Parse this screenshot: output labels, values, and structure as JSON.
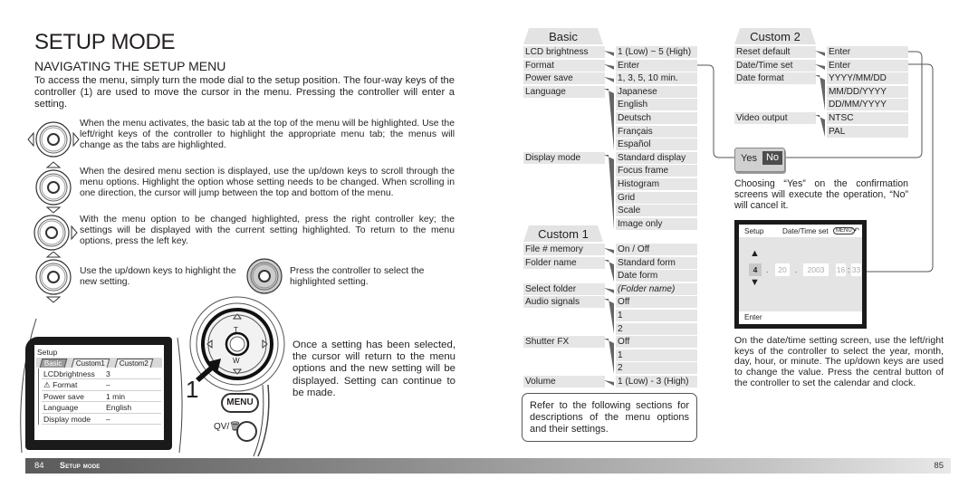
{
  "left_page": {
    "title": "SETUP MODE",
    "section": "NAVIGATING THE SETUP MENU",
    "intro": "To access the menu, simply turn the mode dial to the setup position. The four-way keys of the controller (1) are used to move the cursor in the menu. Pressing the controller will enter a setting.",
    "steps": [
      {
        "icon": "controller-left-right-icon",
        "text": "When the menu activates, the basic tab at the top of the menu will be highlighted. Use the left/right keys of the controller to highlight the appropriate menu tab; the menus will change as the tabs are highlighted."
      },
      {
        "icon": "controller-up-down-icon",
        "text": "When the desired menu section is displayed, use the up/down keys to scroll through the menu options. Highlight the option whose setting needs to be changed. When scrolling in one direction, the cursor will jump between the top and bottom of the menu."
      },
      {
        "icon": "controller-right-icon",
        "text": "With the menu option to be changed highlighted, press the right controller key; the settings will be displayed with the current setting highlighted. To return to the menu options, press the left key."
      },
      {
        "icon": "controller-up-down-icon",
        "text": "Use the up/down keys to highlight the new setting."
      },
      {
        "icon": "controller-center-press-icon",
        "text": "Press the controller to select the highlighted setting."
      }
    ],
    "camera_lcd": {
      "header": "Setup",
      "tabs": [
        "Basic",
        "Custom1",
        "Custom2"
      ],
      "active_tab": "Basic",
      "rows": [
        {
          "label": "LCDbrightness",
          "value": "3"
        },
        {
          "label": "Format",
          "value": "–",
          "icon": "warning-icon"
        },
        {
          "label": "Power save",
          "value": "1 min"
        },
        {
          "label": "Language",
          "value": "English"
        },
        {
          "label": "Display mode",
          "value": "–"
        }
      ]
    },
    "controller_labels": {
      "top": "T",
      "bottom": "W"
    },
    "callout_number": "1",
    "menu_button": "MENU",
    "qv_label": "QV/",
    "outcome_text": "Once a setting has been selected, the cursor will return to the menu options and the new setting will be displayed. Setting can continue to be made."
  },
  "right_page": {
    "basic": {
      "tab": "Basic",
      "items": [
        {
          "label": "LCD brightness",
          "options": [
            "1 (Low) ~ 5 (High)"
          ]
        },
        {
          "label": "Format",
          "options": [
            "Enter"
          ]
        },
        {
          "label": "Power save",
          "options": [
            "1, 3, 5, 10 min."
          ]
        },
        {
          "label": "Language",
          "options": [
            "Japanese",
            "English",
            "Deutsch",
            "Français",
            "Español"
          ]
        },
        {
          "label": "Display mode",
          "options": [
            "Standard display",
            "Focus frame",
            "Histogram",
            "Grid",
            "Scale",
            "Image only"
          ]
        }
      ]
    },
    "custom1": {
      "tab": "Custom 1",
      "items": [
        {
          "label": "File # memory",
          "options": [
            "On / Off"
          ]
        },
        {
          "label": "Folder name",
          "options": [
            "Standard form",
            "Date form"
          ]
        },
        {
          "label": "Select folder",
          "options": [
            "(Folder name)"
          ],
          "italic": true
        },
        {
          "label": "Audio signals",
          "options": [
            "Off",
            "1",
            "2"
          ]
        },
        {
          "label": "Shutter FX",
          "options": [
            "Off",
            "1",
            "2"
          ]
        },
        {
          "label": "Volume",
          "options": [
            "1 (Low) - 3 (High)"
          ]
        }
      ]
    },
    "custom2": {
      "tab": "Custom 2",
      "items": [
        {
          "label": "Reset default",
          "options": [
            "Enter"
          ]
        },
        {
          "label": "Date/Time set",
          "options": [
            "Enter"
          ]
        },
        {
          "label": "Date format",
          "options": [
            "YYYY/MM/DD",
            "MM/DD/YYYY",
            "DD/MM/YYYY"
          ]
        },
        {
          "label": "Video output",
          "options": [
            "NTSC",
            "PAL"
          ]
        }
      ]
    },
    "note": "Refer to the following sections for descriptions of the menu options and their settings.",
    "confirm": {
      "yes": "Yes",
      "no": "No",
      "selected": "No"
    },
    "confirm_text": "Choosing “Yes” on the confirmation screens will execute the operation, “No” will cancel it.",
    "datetime_screen": {
      "left": "Setup",
      "title": "Date/Time set",
      "menu_hint": "MENU",
      "back_glyph": ":↶",
      "month": "4",
      "day": "20",
      "year": "2003",
      "hour": "16",
      "minute": "33",
      "date_sep": ".",
      "time_sep": ":",
      "footer": "Enter"
    },
    "datetime_text": "On the date/time setting screen, use the left/right keys of the controller to select the year, month, day, hour, or minute. The up/down keys are used to change the value. Press the central button of the controller to set the calendar and clock."
  },
  "footer": {
    "left_page_number": "84",
    "section": "Setup mode",
    "right_page_number": "85"
  }
}
